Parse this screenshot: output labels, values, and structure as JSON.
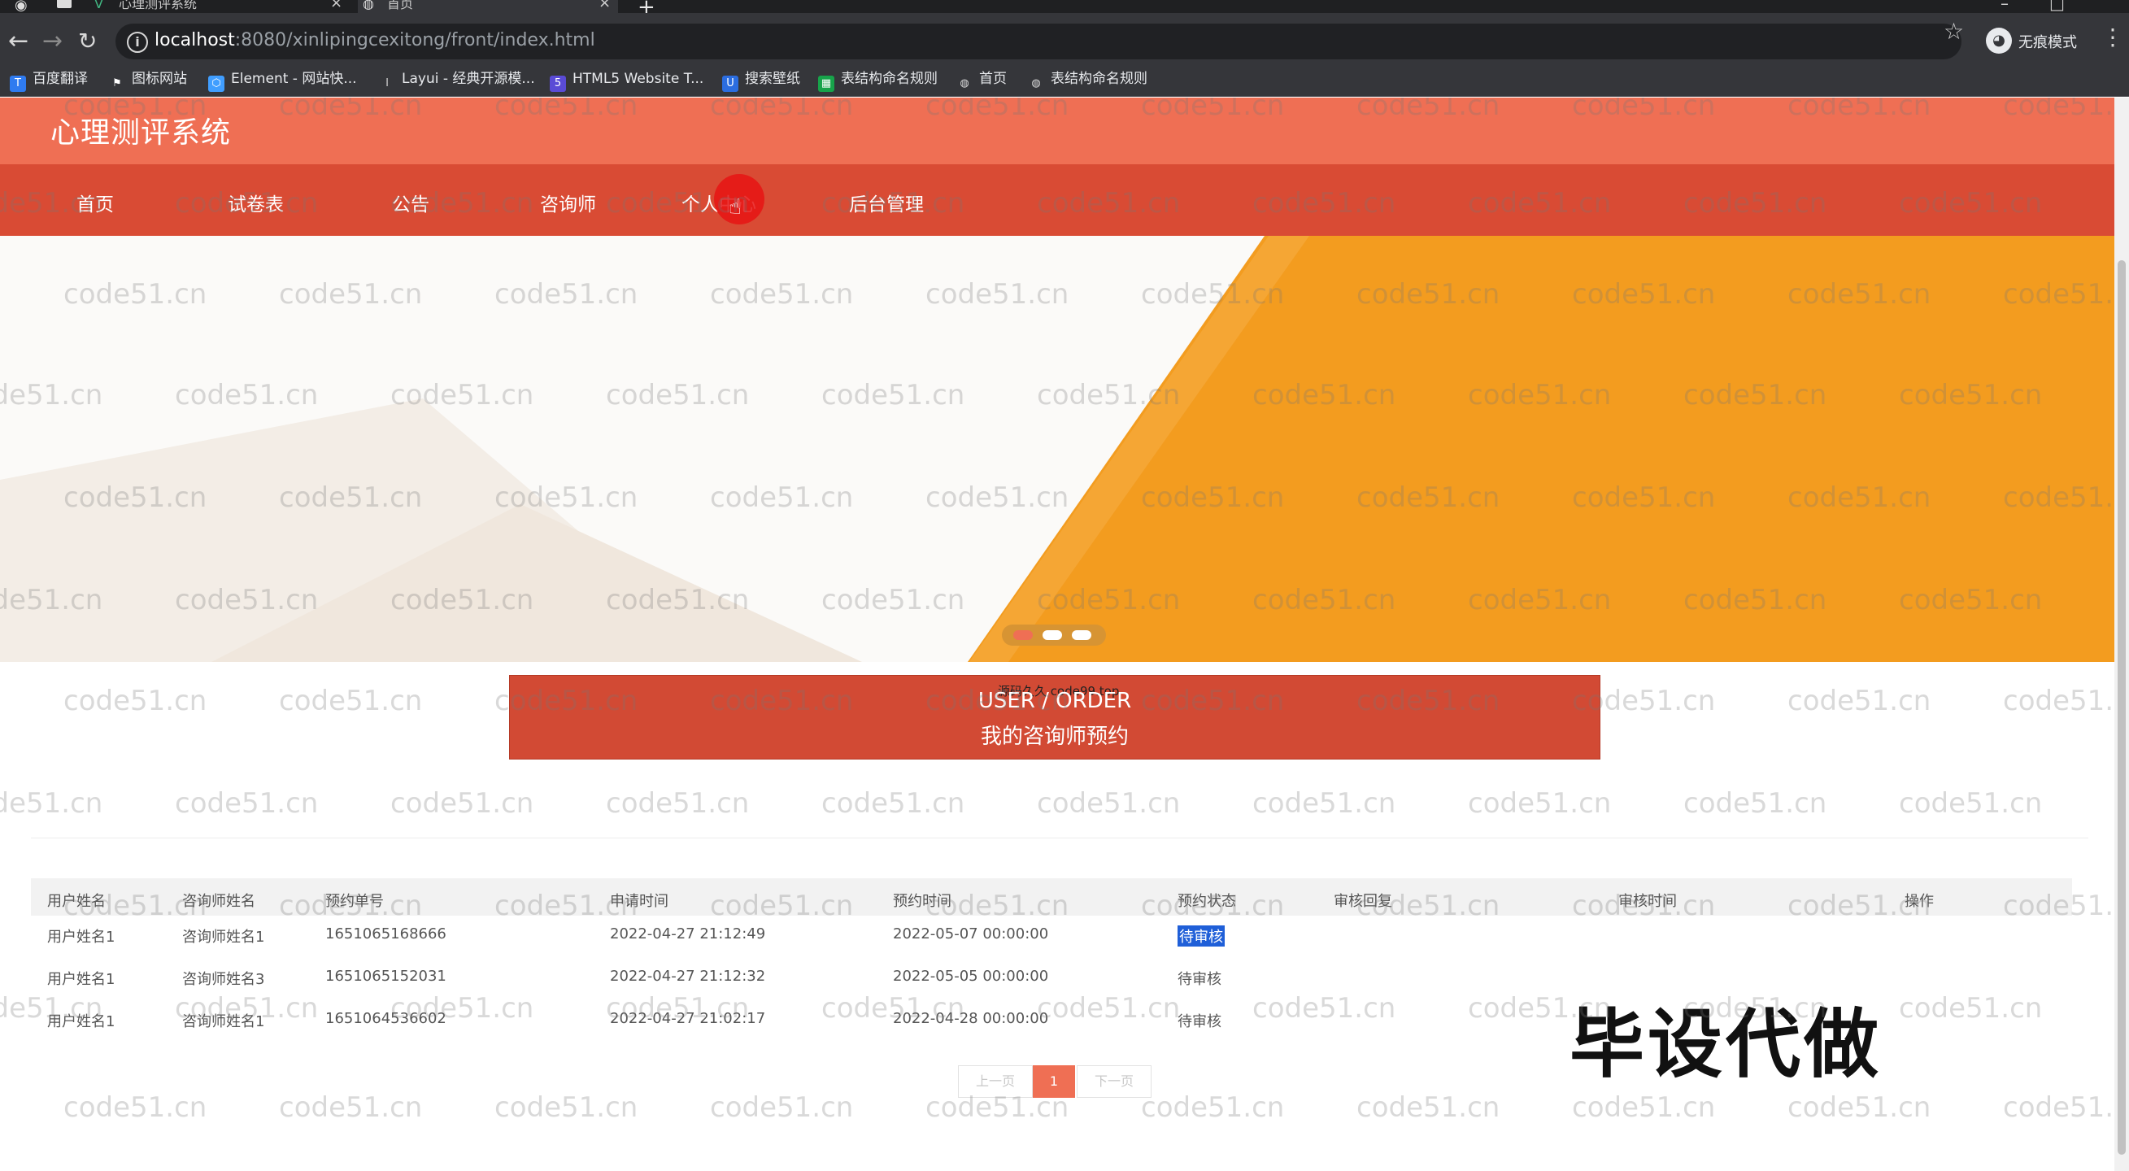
{
  "browser": {
    "tabs": [
      {
        "title": "心理测评系统",
        "active": false
      },
      {
        "title": "首页",
        "active": true
      }
    ],
    "url_host": "localhost",
    "url_path": ":8080/xinlipingcexitong/front/index.html",
    "incognito_label": "无痕模式",
    "bookmarks": [
      {
        "label": "百度翻译",
        "icon": "translate-icon",
        "color": "#2f7bf0"
      },
      {
        "label": "图标网站",
        "icon": "flag-icon",
        "color": "#444"
      },
      {
        "label": "Element - 网站快...",
        "icon": "element-icon",
        "color": "#409eff"
      },
      {
        "label": "Layui - 经典开源模...",
        "icon": "layui-icon",
        "color": "#666"
      },
      {
        "label": "HTML5 Website T...",
        "icon": "html5-icon",
        "color": "#5a4bd6"
      },
      {
        "label": "搜索壁纸",
        "icon": "wallpaper-icon",
        "color": "#2b6de0"
      },
      {
        "label": "表结构命名规则",
        "icon": "sheet-icon",
        "color": "#17a34a"
      },
      {
        "label": "首页",
        "icon": "globe-icon",
        "color": "#999"
      },
      {
        "label": "表结构命名规则",
        "icon": "globe-icon",
        "color": "#999"
      }
    ]
  },
  "site": {
    "title": "心理测评系统",
    "nav": [
      "首页",
      "试卷表",
      "公告",
      "咨询师",
      "个人中心",
      "后台管理"
    ],
    "colors": {
      "header": "#ef6f54",
      "nav": "#d94b34",
      "accent": "#f39c1f"
    }
  },
  "order_banner": {
    "overlay_text": "源码久久 code99.top",
    "title_en": "USER / ORDER",
    "title_cn": "我的咨询师预约"
  },
  "table": {
    "headers": [
      "用户姓名",
      "咨询师姓名",
      "预约单号",
      "申请时间",
      "预约时间",
      "预约状态",
      "审核回复",
      "审核时间",
      "操作"
    ],
    "rows": [
      [
        "用户姓名1",
        "咨询师姓名1",
        "1651065168666",
        "2022-04-27 21:12:49",
        "2022-05-07 00:00:00",
        "待审核",
        "",
        "",
        ""
      ],
      [
        "用户姓名1",
        "咨询师姓名3",
        "1651065152031",
        "2022-04-27 21:12:32",
        "2022-05-05 00:00:00",
        "待审核",
        "",
        "",
        ""
      ],
      [
        "用户姓名1",
        "咨询师姓名1",
        "1651064536602",
        "2022-04-27 21:02:17",
        "2022-04-28 00:00:00",
        "待审核",
        "",
        "",
        ""
      ]
    ]
  },
  "pagination": {
    "prev": "上一页",
    "current": "1",
    "next": "下一页"
  },
  "stamp_text": "毕设代做",
  "watermark": "code51.cn"
}
